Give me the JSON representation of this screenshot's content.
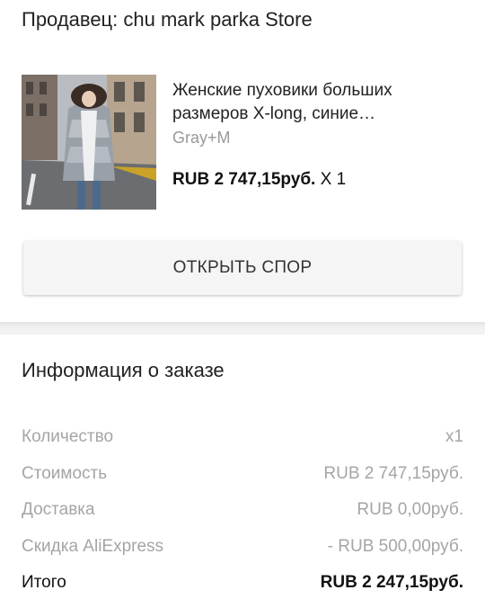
{
  "seller": {
    "label": "Продавец: chu mark parka Store"
  },
  "product": {
    "image_icon": "product-photo-woman-in-silver-puffer-coat",
    "title": "Женские пуховики больших размеров X-long, синие повседневные",
    "variant": "Gray+M",
    "price": "RUB 2 747,15руб.",
    "quantity": "X 1"
  },
  "actions": {
    "dispute_label": "ОТКРЫТЬ СПОР"
  },
  "order_info": {
    "title": "Информация о заказе",
    "rows": [
      {
        "label": "Количество",
        "value": "x1"
      },
      {
        "label": "Стоимость",
        "value": "RUB 2 747,15руб."
      },
      {
        "label": "Доставка",
        "value": "RUB 0,00руб."
      },
      {
        "label": "Скидка AliExpress",
        "value": "- RUB 500,00руб."
      },
      {
        "label": "Итого",
        "value": "RUB 2 247,15руб."
      }
    ]
  },
  "colors": {
    "muted_text": "#a5a5a5",
    "button_bg": "#f5f5f5"
  }
}
